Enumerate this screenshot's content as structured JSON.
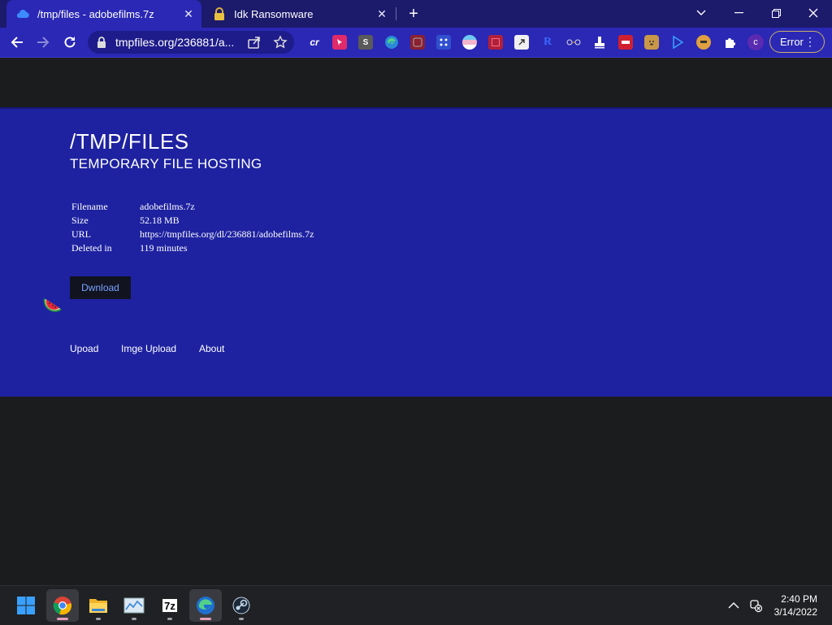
{
  "browser": {
    "tabs": [
      {
        "title": "/tmp/files - adobefilms.7z",
        "active": true,
        "favicon": "cloud-icon"
      },
      {
        "title": "Idk Ransomware",
        "active": false,
        "favicon": "lock-icon"
      }
    ],
    "new_tab": "+",
    "url": "tmpfiles.org/236881/a...",
    "profile_initial": "c",
    "error_label": "Error",
    "extensions": [
      {
        "name": "cr-extension-icon",
        "label": "cr",
        "color": "#2a28b4"
      },
      {
        "name": "pointer-extension-icon",
        "label": "",
        "color": "#e02a6a"
      },
      {
        "name": "s-extension-icon",
        "label": "S",
        "color": "#5a5a5a"
      },
      {
        "name": "edge-extension-icon",
        "label": "",
        "color": "#2a7ad0"
      },
      {
        "name": "red-square-extension-icon",
        "label": "",
        "color": "#8a2030"
      },
      {
        "name": "grid-extension-icon",
        "label": "",
        "color": "#3050d0"
      },
      {
        "name": "flag-extension-icon",
        "label": "",
        "color": "#d8a0c8"
      },
      {
        "name": "red-frame-extension-icon",
        "label": "",
        "color": "#b0203a"
      },
      {
        "name": "document-extension-icon",
        "label": "",
        "color": "#f0f0f0"
      },
      {
        "name": "r-extension-icon",
        "label": "R",
        "color": "#2a28b4"
      },
      {
        "name": "chain-extension-icon",
        "label": "",
        "color": "#2a28b4"
      },
      {
        "name": "stamp-extension-icon",
        "label": "",
        "color": "#2a28b4"
      },
      {
        "name": "red-card-extension-icon",
        "label": "",
        "color": "#d02030"
      },
      {
        "name": "doge-extension-icon",
        "label": "",
        "color": "#c89848"
      },
      {
        "name": "play-extension-icon",
        "label": "",
        "color": "#2a28b4"
      },
      {
        "name": "avatar-extension-icon",
        "label": "",
        "color": "#e0a040"
      },
      {
        "name": "puzzle-extension-icon",
        "label": "",
        "color": "#2a28b4"
      }
    ]
  },
  "site": {
    "title": "/TMP/FILES",
    "subtitle": "TEMPORARY FILE HOSTING",
    "info": [
      {
        "key": "Filename",
        "value": "adobefilms.7z"
      },
      {
        "key": "Size",
        "value": "52.18 MB"
      },
      {
        "key": "URL",
        "value": "https://tmpfiles.org/dl/236881/adobefilms.7z"
      },
      {
        "key": "Deleted in",
        "value": "119 minutes"
      }
    ],
    "download_label": "Dwnload",
    "footer_links": [
      "Upoad",
      "Imge Upload",
      "About"
    ]
  },
  "taskbar": {
    "time": "2:40 PM",
    "date": "3/14/2022"
  }
}
